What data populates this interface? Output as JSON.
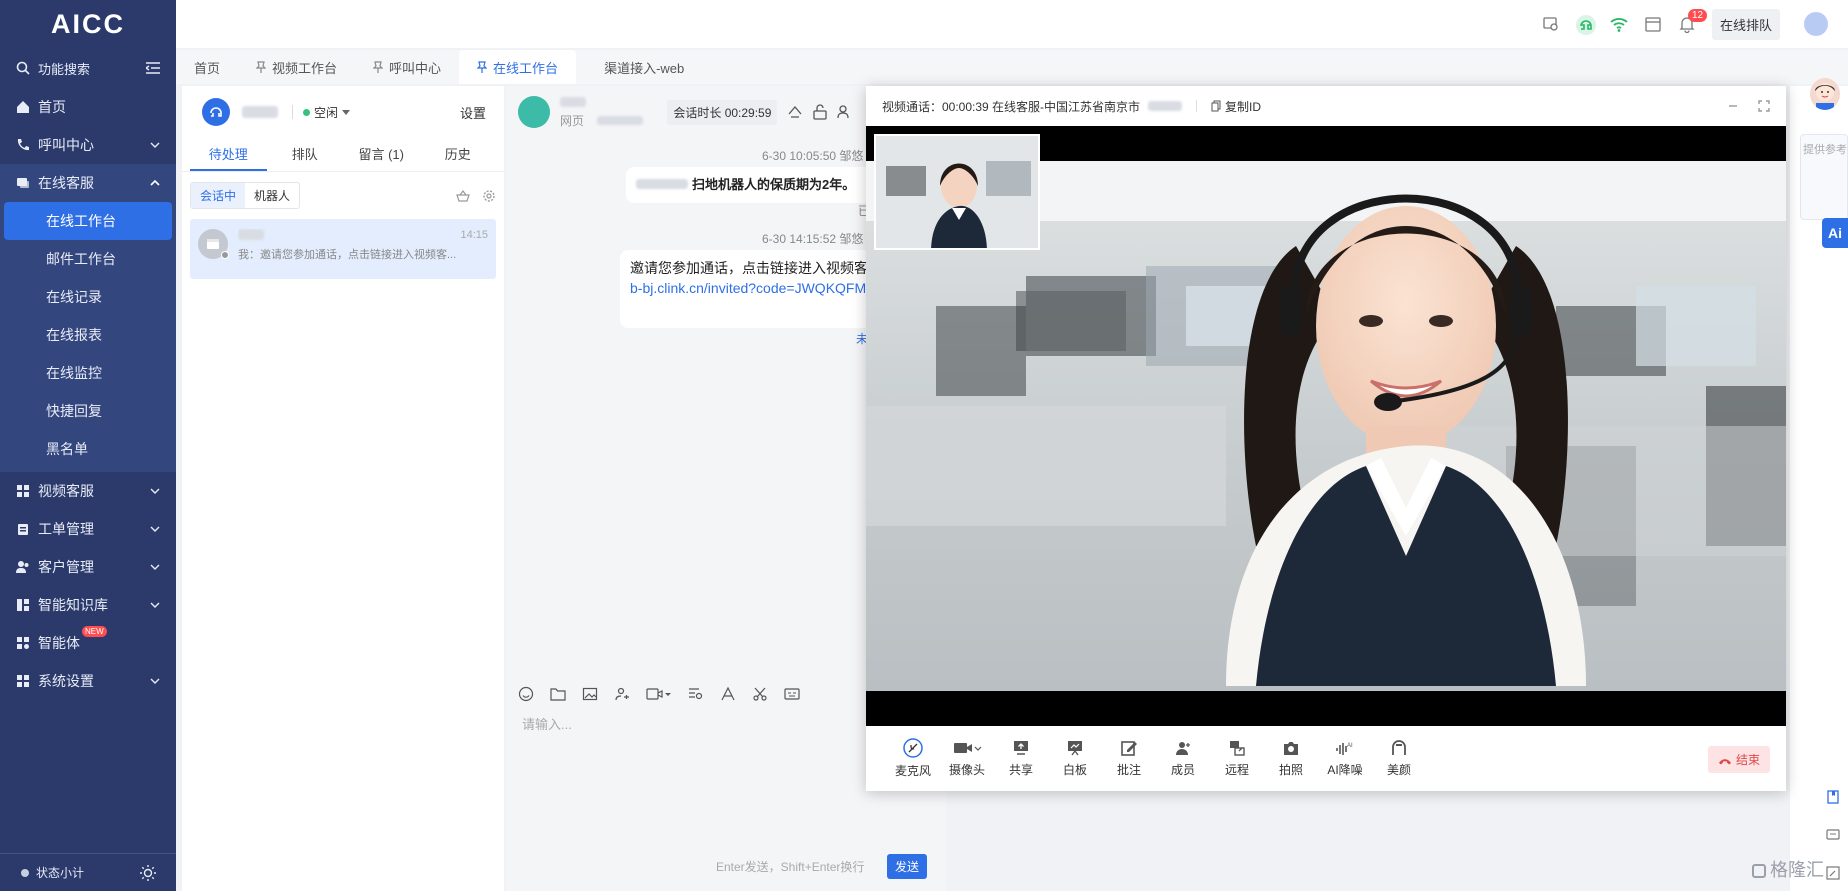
{
  "app": {
    "logo": "AICC"
  },
  "sidebar": {
    "search_label": "功能搜索",
    "items": [
      {
        "label": "首页"
      },
      {
        "label": "呼叫中心"
      },
      {
        "label": "在线客服"
      },
      {
        "label": "视频客服"
      },
      {
        "label": "工单管理"
      },
      {
        "label": "客户管理"
      },
      {
        "label": "智能知识库"
      },
      {
        "label": "智能体",
        "badge": "NEW"
      },
      {
        "label": "系统设置"
      }
    ],
    "sub_items": [
      "在线工作台",
      "邮件工作台",
      "在线记录",
      "在线报表",
      "在线监控",
      "快捷回复",
      "黑名单"
    ],
    "footer_label": "状态小计"
  },
  "topbar": {
    "bell_count": "12",
    "queue_label": "在线排队"
  },
  "tabs": [
    "首页",
    "视频工作台",
    "呼叫中心",
    "在线工作台",
    "渠道接入-web"
  ],
  "left_panel": {
    "status": "空闲",
    "settings": "设置",
    "tabs": [
      "待处理",
      "排队",
      "留言 (1)",
      "历史"
    ],
    "seg": [
      "会话中",
      "机器人"
    ],
    "conv": {
      "time": "14:15",
      "msg": "我：邀请您参加通话，点击链接进入视频客..."
    }
  },
  "chat": {
    "source": "网页",
    "duration": "会话时长 00:29:59",
    "msg1_time": "6-30 10:05:50 邹悠",
    "msg1_text": "扫地机器人的保质期为2年。",
    "msg1_status": "已",
    "msg2_time": "6-30 14:15:52 邹悠",
    "msg2_text": "邀请您参加通话，点击链接进入视频客服",
    "msg2_link": "https://vcs-web-bj.clink.cn/invited?code=JWQKQFMWXB",
    "msg2_status": "未",
    "placeholder": "请输入...",
    "send_hint": "Enter发送，Shift+Enter换行",
    "send_label": "发送"
  },
  "video": {
    "title": "视频通话：00:00:39  在线客服-中国江苏省南京市",
    "copy_id": "复制ID",
    "controls": [
      "麦克风",
      "摄像头",
      "共享",
      "白板",
      "批注",
      "成员",
      "远程",
      "拍照",
      "AI降噪",
      "美颜"
    ],
    "end_label": "结束"
  },
  "right_strip": {
    "hint": "提供参考",
    "ai": "Ai"
  },
  "watermark": "格隆汇",
  "colors": {
    "sidebar": "#2b3a6b",
    "accent": "#2f6fe6",
    "end": "#e04848"
  }
}
